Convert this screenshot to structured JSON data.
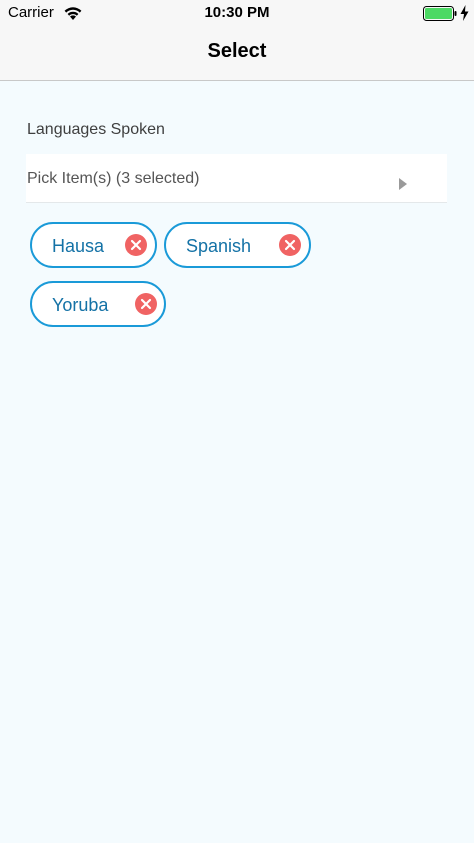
{
  "status_bar": {
    "carrier": "Carrier",
    "time": "10:30 PM",
    "icons": [
      "wifi-icon",
      "battery-icon",
      "charging-bolt-icon"
    ],
    "battery_color": "#4cd964"
  },
  "nav": {
    "title": "Select"
  },
  "form": {
    "label": "Languages Spoken",
    "picker_text": "Pick Item(s) (3 selected)",
    "selected": [
      {
        "label": "Hausa"
      },
      {
        "label": "Spanish"
      },
      {
        "label": "Yoruba"
      }
    ]
  },
  "colors": {
    "chip_border": "#1a9ad8",
    "chip_text": "#1472a6",
    "remove_badge": "#f06363",
    "background": "#f4fbfe"
  }
}
